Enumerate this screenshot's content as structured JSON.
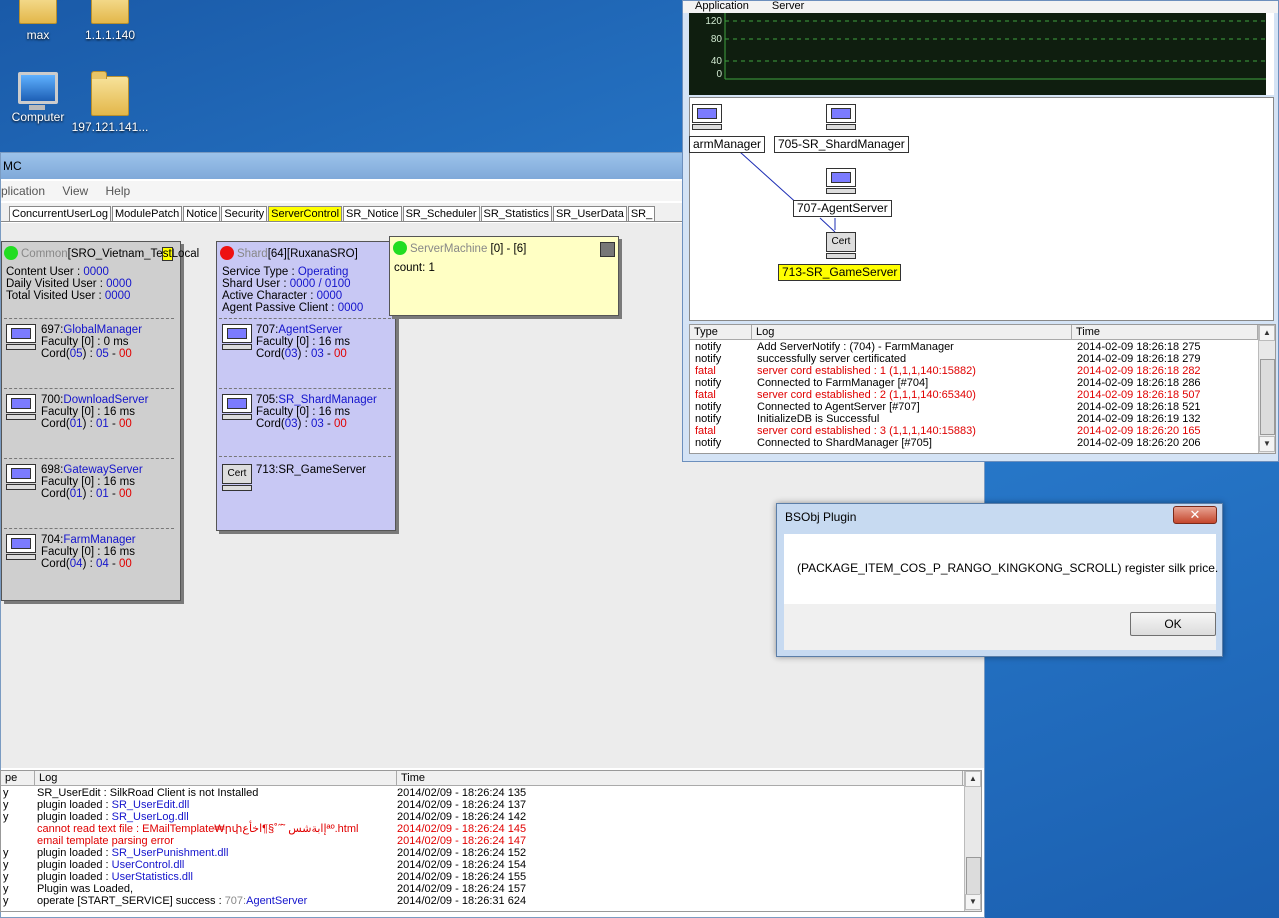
{
  "desktop": {
    "icons": [
      {
        "label": "max"
      },
      {
        "label": "1.1.1.140"
      },
      {
        "label": "Computer"
      },
      {
        "label": "197.121.141..."
      }
    ]
  },
  "main_window": {
    "title": "MC",
    "menu": [
      "plication",
      "View",
      "Help"
    ],
    "tabs": [
      "ConcurrentUserLog",
      "ModulePatch",
      "Notice",
      "Security",
      "ServerControl",
      "SR_Notice",
      "SR_Scheduler",
      "SR_Statistics",
      "SR_UserData",
      "SR_"
    ],
    "active_tab": "ServerControl",
    "common_card": {
      "title_prefix": "Common",
      "title_name": "[SRO_Vietnam_Te",
      "title_hl": "st",
      "title_suffix": "Local",
      "status_color": "#22dd22",
      "content_user_label": "Content User : ",
      "content_user": "0000",
      "daily_label": "Daily Visited User : ",
      "daily": "0000",
      "total_label": "Total Visited User : ",
      "total": "0000",
      "servers": [
        {
          "id": "697:",
          "name": "GlobalManager",
          "faculty": "Faculty [0] : 0 ms",
          "cord_pre": "Cord(",
          "cord_a": "05",
          "cord_mid": ") : ",
          "cord_b": "05",
          "cord_dash": " - ",
          "cord_c": "00"
        },
        {
          "id": "700:",
          "name": "DownloadServer",
          "faculty": "Faculty [0] : 16 ms",
          "cord_pre": "Cord(",
          "cord_a": "01",
          "cord_mid": ") : ",
          "cord_b": "01",
          "cord_dash": " - ",
          "cord_c": "00"
        },
        {
          "id": "698:",
          "name": "GatewayServer",
          "faculty": "Faculty [0] : 16 ms",
          "cord_pre": "Cord(",
          "cord_a": "01",
          "cord_mid": ") : ",
          "cord_b": "01",
          "cord_dash": " - ",
          "cord_c": "00"
        },
        {
          "id": "704:",
          "name": "FarmManager",
          "faculty": "Faculty [0] : 16 ms",
          "cord_pre": "Cord(",
          "cord_a": "04",
          "cord_mid": ") : ",
          "cord_b": "04",
          "cord_dash": " - ",
          "cord_c": "00"
        }
      ]
    },
    "shard_card": {
      "title_prefix": "Shard",
      "title_name": "[64][RuxanaSRO]",
      "status_color": "#ee1111",
      "service_type_label": "Service Type : ",
      "service_type": "Operating",
      "shard_user_label": "Shard User : ",
      "shard_user": "0000 / 0100",
      "active_char_label": "Active Character : ",
      "active_char": "0000",
      "agent_passive_label": "Agent Passive Client : ",
      "agent_passive": "0000",
      "servers": [
        {
          "id": "707:",
          "name": "AgentServer",
          "faculty": "Faculty [0] : 16 ms",
          "cord_pre": "Cord(",
          "cord_a": "03",
          "cord_mid": ") : ",
          "cord_b": "03",
          "cord_dash": " - ",
          "cord_c": "00"
        },
        {
          "id": "705:",
          "name": "SR_ShardManager",
          "faculty": "Faculty [0] : 16 ms",
          "cord_pre": "Cord(",
          "cord_a": "03",
          "cord_mid": ") : ",
          "cord_b": "03",
          "cord_dash": " - ",
          "cord_c": "00"
        }
      ],
      "cert_icon_label": "Cert",
      "game_server": "713:SR_GameServer"
    },
    "machine_card": {
      "title_prefix": "ServerMachine",
      "title_counts": " [0] - [6]",
      "status_color": "#22dd22",
      "count": "count: 1"
    },
    "log": {
      "col_type": "pe",
      "col_log": "Log",
      "col_time": "Time",
      "rows": [
        {
          "type": "y",
          "msg": "SR_UserEdit : SilkRoad Client is not Installed",
          "msg_blue": "",
          "time": "2014/02/09 - 18:26:24 135",
          "error": false
        },
        {
          "type": "y",
          "msg": "plugin loaded : ",
          "msg_blue": "SR_UserEdit.dll",
          "time": "2014/02/09 - 18:26:24 137",
          "error": false
        },
        {
          "type": "y",
          "msg": "plugin loaded : ",
          "msg_blue": "SR_UserLog.dll",
          "time": "2014/02/09 - 18:26:24 142",
          "error": false
        },
        {
          "type": "",
          "msg": "cannot read text file : EMailTemplate₩րփإابةشس ˜˝˚§¶اخأعªº.html",
          "msg_blue": "",
          "time": "2014/02/09 - 18:26:24 145",
          "error": true
        },
        {
          "type": "",
          "msg": "email template parsing error",
          "msg_blue": "",
          "time": "2014/02/09 - 18:26:24 147",
          "error": true
        },
        {
          "type": "y",
          "msg": "plugin loaded : ",
          "msg_blue": "SR_UserPunishment.dll",
          "time": "2014/02/09 - 18:26:24 152",
          "error": false
        },
        {
          "type": "y",
          "msg": "plugin loaded : ",
          "msg_blue": "UserControl.dll",
          "time": "2014/02/09 - 18:26:24 154",
          "error": false
        },
        {
          "type": "y",
          "msg": "plugin loaded : ",
          "msg_blue": "UserStatistics.dll",
          "time": "2014/02/09 - 18:26:24 155",
          "error": false
        },
        {
          "type": "y",
          "msg": "Plugin was Loaded,",
          "msg_blue": "",
          "time": "2014/02/09 - 18:26:24 157",
          "error": false
        },
        {
          "type": "y",
          "msg": "operate [START_SERVICE] success : ",
          "msg_gray": "707:",
          "msg_blue": "AgentServer",
          "time": "2014/02/09 - 18:26:31 624",
          "error": false
        }
      ]
    }
  },
  "monitor_window": {
    "menu": [
      "Application",
      "Server"
    ],
    "graph": {
      "ticks": [
        "120",
        "80",
        "40",
        "0"
      ],
      "line_color": "#3fa13f"
    },
    "nodes": {
      "farm": "armManager",
      "shard": "705-SR_ShardManager",
      "agent": "707-AgentServer",
      "cert_label": "Cert",
      "game": "713-SR_GameServer"
    },
    "log": {
      "col_type": "Type",
      "col_log": "Log",
      "col_time": "Time",
      "rows": [
        {
          "type": "notify",
          "msg": "Add ServerNotify : (704) - FarmManager",
          "time": "2014-02-09 18:26:18 275",
          "fatal": false
        },
        {
          "type": "notify",
          "msg": "successfully server certificated",
          "time": "2014-02-09 18:26:18 279",
          "fatal": false
        },
        {
          "type": "fatal",
          "msg": "server cord established : 1 (1,1,1,140:15882)",
          "time": "2014-02-09 18:26:18 282",
          "fatal": true
        },
        {
          "type": "notify",
          "msg": "Connected to FarmManager [#704]",
          "time": "2014-02-09 18:26:18 286",
          "fatal": false
        },
        {
          "type": "fatal",
          "msg": "server cord established : 2 (1,1,1,140:65340)",
          "time": "2014-02-09 18:26:18 507",
          "fatal": true
        },
        {
          "type": "notify",
          "msg": "Connected to AgentServer [#707]",
          "time": "2014-02-09 18:26:18 521",
          "fatal": false
        },
        {
          "type": "notify",
          "msg": "InitializeDB is Successful",
          "time": "2014-02-09 18:26:19 132",
          "fatal": false
        },
        {
          "type": "fatal",
          "msg": "server cord established : 3 (1,1,1,140:15883)",
          "time": "2014-02-09 18:26:20 165",
          "fatal": true
        },
        {
          "type": "notify",
          "msg": "Connected to ShardManager [#705]",
          "time": "2014-02-09 18:26:20 206",
          "fatal": false
        }
      ]
    }
  },
  "dialog": {
    "title": "BSObj Plugin",
    "message": "(PACKAGE_ITEM_COS_P_RANGO_KINGKONG_SCROLL) register silk price.",
    "ok_label": "OK",
    "close_glyph": "✕"
  }
}
